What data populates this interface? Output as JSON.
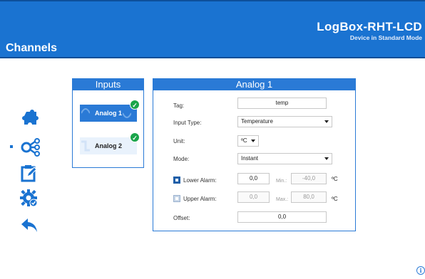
{
  "header": {
    "page_title": "Channels",
    "app_title": "LogBox-RHT-LCD",
    "app_subtitle": "Device in Standard Mode"
  },
  "side_nav": {
    "items": [
      {
        "icon": "puzzle-icon",
        "active": false
      },
      {
        "icon": "channels-icon",
        "active": true
      },
      {
        "icon": "edit-icon",
        "active": false
      },
      {
        "icon": "settings-icon",
        "active": false
      },
      {
        "icon": "back-arrow-icon",
        "active": false
      }
    ]
  },
  "inputs_panel": {
    "title": "Inputs",
    "items": [
      {
        "label": "Analog 1",
        "active": true,
        "status": "ok"
      },
      {
        "label": "Analog 2",
        "active": false,
        "status": "ok"
      }
    ]
  },
  "analog_panel": {
    "title": "Analog 1",
    "tag": {
      "label": "Tag:",
      "value": "temp"
    },
    "input_type": {
      "label": "Input Type:",
      "value": "Temperature"
    },
    "unit": {
      "label": "Unit:",
      "value": "ºC"
    },
    "mode": {
      "label": "Mode:",
      "value": "Instant"
    },
    "lower_alarm": {
      "label": "Lower Alarm:",
      "enabled": true,
      "value": "0,0",
      "limit_label": "Min.:",
      "limit_value": "-40,0",
      "unit": "ºC"
    },
    "upper_alarm": {
      "label": "Upper Alarm:",
      "enabled": false,
      "value": "0,0",
      "limit_label": "Max.:",
      "limit_value": "80,0",
      "unit": "ºC"
    },
    "offset": {
      "label": "Offset:",
      "value": "0,0"
    }
  },
  "info_icon": "i",
  "colors": {
    "header": "#1a73d1",
    "panel_accent": "#2a7ad6",
    "ok_green": "#1aa54b"
  }
}
